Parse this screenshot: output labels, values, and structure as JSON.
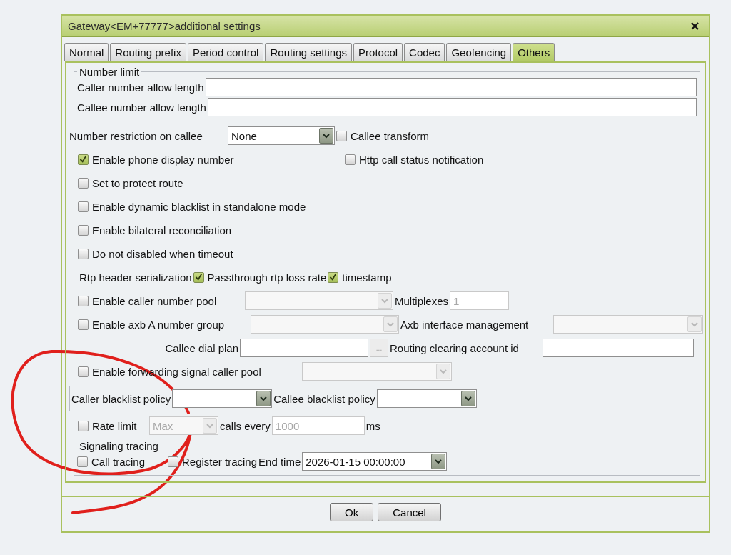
{
  "window": {
    "title": "Gateway<EM+77777>additional settings",
    "close": "×"
  },
  "tabs": [
    {
      "label": "Normal",
      "selected": false
    },
    {
      "label": "Routing prefix",
      "selected": false
    },
    {
      "label": "Period control",
      "selected": false
    },
    {
      "label": "Routing settings",
      "selected": false
    },
    {
      "label": "Protocol",
      "selected": false
    },
    {
      "label": "Codec",
      "selected": false
    },
    {
      "label": "Geofencing",
      "selected": false
    },
    {
      "label": "Others",
      "selected": true
    }
  ],
  "sections": [
    {
      "kind": "group",
      "title": "Number limit",
      "rows": [
        {
          "items": [
            {
              "kind": "label",
              "text": "Caller number allow length"
            },
            {
              "kind": "input",
              "disabled": false
            }
          ]
        },
        {
          "items": [
            {
              "kind": "label",
              "text": "Callee number allow length"
            },
            {
              "kind": "input",
              "disabled": false
            }
          ]
        }
      ]
    },
    {
      "kind": "row",
      "items": [
        {
          "kind": "label",
          "text": "Number restriction on callee"
        },
        {
          "kind": "select",
          "value": "None",
          "disabled": false
        },
        {
          "kind": "checkbox",
          "label": "Callee transform",
          "checked": false
        }
      ]
    },
    {
      "kind": "row",
      "items": [
        {
          "kind": "checkbox",
          "label": "Enable phone display number",
          "checked": true
        },
        {
          "kind": "checkbox",
          "label": "Http call status notification",
          "checked": false
        }
      ]
    },
    {
      "kind": "row",
      "items": [
        {
          "kind": "checkbox",
          "label": "Set to protect route",
          "checked": false
        }
      ]
    },
    {
      "kind": "row",
      "items": [
        {
          "kind": "checkbox",
          "label": "Enable dynamic blacklist in standalone mode",
          "checked": false
        }
      ]
    },
    {
      "kind": "row",
      "items": [
        {
          "kind": "checkbox",
          "label": "Enable bilateral reconciliation",
          "checked": false
        }
      ]
    },
    {
      "kind": "row",
      "items": [
        {
          "kind": "checkbox",
          "label": "Do not disabled when timeout",
          "checked": false
        }
      ]
    },
    {
      "kind": "row",
      "items": [
        {
          "kind": "label",
          "text": "Rtp header serialization"
        },
        {
          "kind": "checkbox",
          "label": "Passthrough rtp loss rate",
          "checked": true
        },
        {
          "kind": "checkbox",
          "label": "timestamp",
          "checked": true
        }
      ]
    },
    {
      "kind": "row",
      "items": [
        {
          "kind": "checkbox",
          "label": "Enable caller number pool",
          "checked": false
        },
        {
          "kind": "select",
          "disabled": true
        },
        {
          "kind": "label",
          "text": "Multiplexes"
        },
        {
          "kind": "input",
          "value": "1",
          "disabled": true
        }
      ]
    },
    {
      "kind": "row",
      "items": [
        {
          "kind": "checkbox",
          "label": "Enable axb A number group",
          "checked": false
        },
        {
          "kind": "select",
          "disabled": true
        },
        {
          "kind": "label",
          "text": "Axb interface management"
        },
        {
          "kind": "select",
          "disabled": true
        }
      ]
    },
    {
      "kind": "row",
      "items": [
        {
          "kind": "label",
          "text": "Callee dial plan"
        },
        {
          "kind": "input",
          "disabled": false
        },
        {
          "kind": "button",
          "label": "...",
          "disabled": true
        },
        {
          "kind": "label",
          "text": "Routing clearing account id"
        },
        {
          "kind": "input",
          "disabled": false
        }
      ]
    },
    {
      "kind": "row",
      "items": [
        {
          "kind": "checkbox",
          "label": "Enable forwarding signal caller pool",
          "checked": false
        },
        {
          "kind": "select",
          "disabled": true
        }
      ]
    },
    {
      "kind": "group",
      "rows": [
        {
          "items": [
            {
              "kind": "label",
              "text": "Caller blacklist policy"
            },
            {
              "kind": "select",
              "disabled": false
            },
            {
              "kind": "label",
              "text": "Callee blacklist policy"
            },
            {
              "kind": "select",
              "disabled": false
            }
          ]
        }
      ]
    },
    {
      "kind": "row",
      "items": [
        {
          "kind": "checkbox",
          "label": "Rate limit",
          "checked": false
        },
        {
          "kind": "select",
          "value": "Max",
          "disabled": true
        },
        {
          "kind": "label",
          "text": "calls every"
        },
        {
          "kind": "input",
          "value": "1000",
          "disabled": true
        },
        {
          "kind": "label",
          "text": "ms"
        }
      ]
    },
    {
      "kind": "group",
      "title": "Signaling tracing",
      "rows": [
        {
          "items": [
            {
              "kind": "checkbox",
              "label": "Call tracing",
              "checked": false
            },
            {
              "kind": "checkbox",
              "label": "Register tracing",
              "checked": false
            },
            {
              "kind": "label",
              "text": "End time"
            },
            {
              "kind": "select",
              "value": "2026-01-15 00:00:00",
              "disabled": false
            }
          ]
        }
      ]
    }
  ],
  "buttons": [
    "Ok",
    "Cancel"
  ]
}
